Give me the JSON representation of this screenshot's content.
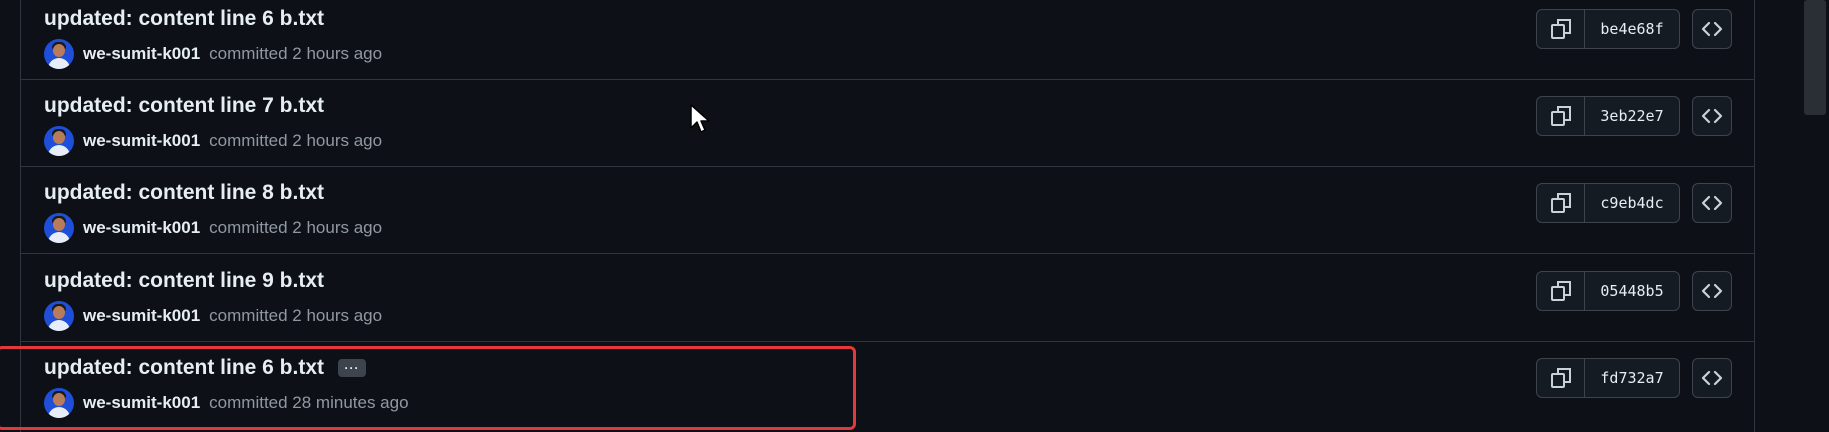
{
  "commits": [
    {
      "title": "updated: content line 6 b.txt",
      "author": "we-sumit-k001",
      "committed": "committed 2 hours ago",
      "sha": "be4e68f"
    },
    {
      "title": "updated: content line 7 b.txt",
      "author": "we-sumit-k001",
      "committed": "committed 2 hours ago",
      "sha": "3eb22e7"
    },
    {
      "title": "updated: content line 8 b.txt",
      "author": "we-sumit-k001",
      "committed": "committed 2 hours ago",
      "sha": "c9eb4dc"
    },
    {
      "title": "updated: content line 9 b.txt",
      "author": "we-sumit-k001",
      "committed": "committed 2 hours ago",
      "sha": "05448b5"
    },
    {
      "title": "updated: content line 6 b.txt",
      "author": "we-sumit-k001",
      "committed": "committed 28 minutes ago",
      "sha": "fd732a7",
      "more_label": "···"
    }
  ],
  "icons": {
    "copy": "copy-icon",
    "browse": "code-icon",
    "avatar": "avatar",
    "cursor": "mouse-cursor-icon"
  },
  "colors": {
    "background": "#0d1117",
    "border": "#30363d",
    "text": "#e6edf3",
    "muted": "#9198a1",
    "highlight": "#e5383b"
  }
}
